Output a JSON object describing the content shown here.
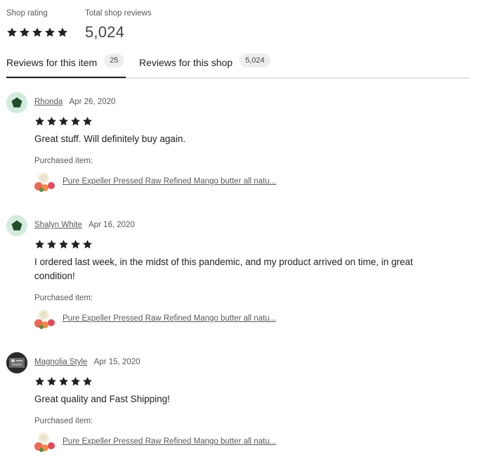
{
  "summary": {
    "shop_rating_label": "Shop rating",
    "shop_rating_stars": 5,
    "total_reviews_label": "Total shop reviews",
    "total_reviews_value": "5,024"
  },
  "tabs": [
    {
      "label": "Reviews for this item",
      "count": "25",
      "active": true
    },
    {
      "label": "Reviews for this shop",
      "count": "5,024",
      "active": false
    }
  ],
  "reviews": [
    {
      "name": "Rhonda",
      "date": "Apr 26, 2020",
      "stars": 5,
      "text": "Great stuff. Will definitely buy again.",
      "purchased_label": "Purchased item:",
      "item_title": "Pure Expeller Pressed Raw Refined Mango butter all natu..."
    },
    {
      "name": "Shalyn White",
      "date": "Apr 16, 2020",
      "stars": 5,
      "text": "I ordered last week, in the midst of this pandemic, and my product arrived on time, in great condition!",
      "purchased_label": "Purchased item:",
      "item_title": "Pure Expeller Pressed Raw Refined Mango butter all natu..."
    },
    {
      "name": "Magnolia Style",
      "date": "Apr 15, 2020",
      "stars": 5,
      "text": "Great quality and Fast Shipping!",
      "purchased_label": "Purchased item:",
      "item_title": "Pure Expeller Pressed Raw Refined Mango butter all natu..."
    }
  ],
  "colors": {
    "text": "#222222",
    "muted": "#595959",
    "avatar_green_bg": "#d3ebdd",
    "avatar_green_shape": "#1f4d2b",
    "divider": "#e1e1e1"
  },
  "icons": {
    "star": "star-icon",
    "avatar_default": "pentagon-avatar-icon"
  }
}
